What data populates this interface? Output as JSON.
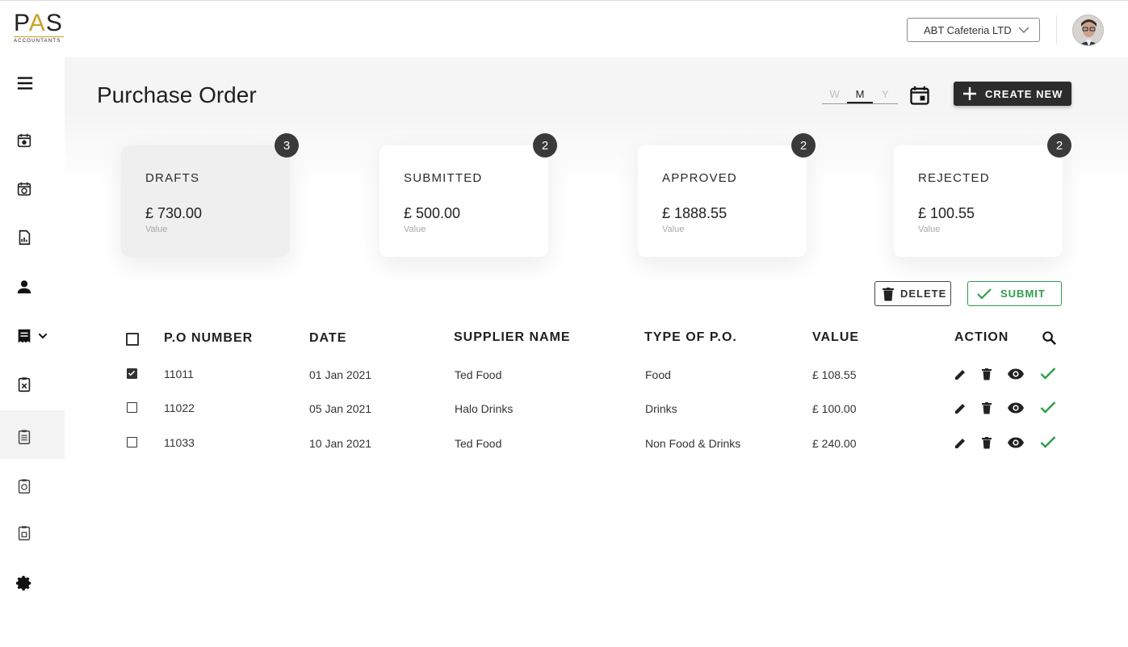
{
  "brand": {
    "logo_text": "PAS",
    "logo_sub": "ACCOUNTANTS"
  },
  "header": {
    "company": "ABT Cafeteria LTD"
  },
  "page": {
    "title": "Purchase Order",
    "period": {
      "options": [
        "W",
        "M",
        "Y"
      ],
      "selected": "M"
    },
    "create_label": "CREATE NEW"
  },
  "cards": [
    {
      "title": "DRAFTS",
      "amount": "£ 730.00",
      "label": "Value",
      "count": "3",
      "selected": true
    },
    {
      "title": "SUBMITTED",
      "amount": "£ 500.00",
      "label": "Value",
      "count": "2",
      "selected": false
    },
    {
      "title": "APPROVED",
      "amount": "£ 1888.55",
      "label": "Value",
      "count": "2",
      "selected": false
    },
    {
      "title": "REJECTED",
      "amount": "£ 100.55",
      "label": "Value",
      "count": "2",
      "selected": false
    }
  ],
  "actions": {
    "delete_label": "DELETE",
    "submit_label": "SUBMIT"
  },
  "table": {
    "headers": [
      "P.O NUMBER",
      "DATE",
      "SUPPLIER NAME",
      "TYPE OF P.O.",
      "VALUE",
      "ACTION"
    ],
    "rows": [
      {
        "po": "11011",
        "date": "01 Jan 2021",
        "supplier": "Ted Food",
        "type": "Food",
        "value": "£ 108.55",
        "checked": true
      },
      {
        "po": "11022",
        "date": "05 Jan 2021",
        "supplier": "Halo Drinks",
        "type": "Drinks",
        "value": "£ 100.00",
        "checked": false
      },
      {
        "po": "11033",
        "date": "10 Jan 2021",
        "supplier": "Ted Food",
        "type": "Non Food & Drinks",
        "value": "£ 240.00",
        "checked": false
      }
    ]
  },
  "colors": {
    "accent_dark": "#2c2c2c",
    "success": "#2e9d4c",
    "logo_gold": "#c9a227"
  },
  "sidebar_icons": [
    "menu-icon",
    "calendar-dashboard-icon",
    "calendar-sync-icon",
    "report-icon",
    "person-icon",
    "receipt-icon",
    "clipboard-icon",
    "clipboard-list-icon",
    "clipboard-check-icon",
    "clipboard-doc-icon",
    "settings-icon"
  ]
}
